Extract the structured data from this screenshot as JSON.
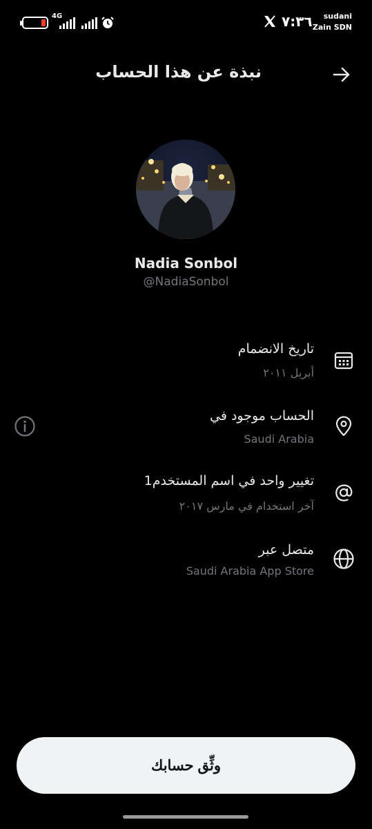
{
  "status_bar": {
    "network_type": "4G",
    "time": "٧:٣٦",
    "carrier_line1": "sudani",
    "carrier_line2": "Zain SDN",
    "battery_icon": "battery-low-icon",
    "alarm_icon": "alarm-clock-icon",
    "app_icon": "x-logo-icon"
  },
  "header": {
    "title": "نبذة عن هذا الحساب",
    "back_icon": "arrow-right-icon"
  },
  "profile": {
    "display_name": "Nadia Sonbol",
    "username": "@NadiaSonbol"
  },
  "info_rows": [
    {
      "title": "تاريخ الانضمام",
      "subtitle": "أبريل ٢٠١١",
      "icon": "calendar-icon"
    },
    {
      "title": "الحساب موجود في",
      "subtitle": "Saudi Arabia",
      "icon": "location-pin-icon"
    },
    {
      "title": "تغيير واحد في اسم المستخدم1",
      "subtitle": "آخر استخدام في مارس ٢٠١٧",
      "icon": "at-sign-icon"
    },
    {
      "title": "متصل عبر",
      "subtitle": "Saudi Arabia App Store",
      "icon": "globe-icon"
    }
  ],
  "info_button_icon": "info-circle-icon",
  "verify_button": {
    "label": "وثِّق حسابك"
  },
  "colors": {
    "background": "#000000",
    "primary_text": "#e7e9ea",
    "secondary_text": "#71767b",
    "button_bg": "#eff3f4",
    "battery_low": "#ff3b30"
  }
}
